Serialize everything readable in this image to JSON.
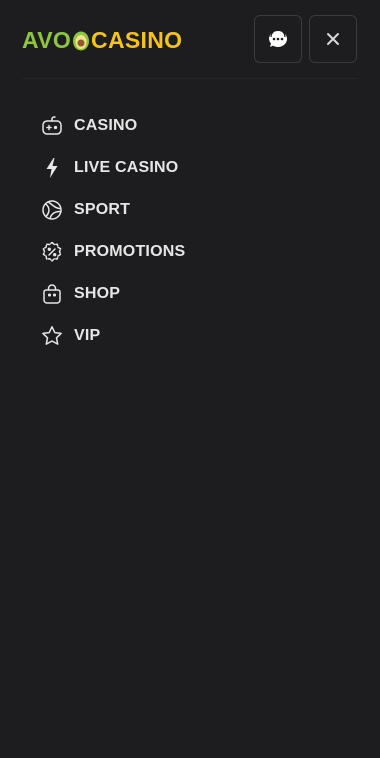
{
  "header": {
    "logo_left": "AVO",
    "logo_right": "CASINO",
    "chat_icon": "support-chat-icon",
    "close_icon": "close-icon"
  },
  "menu": {
    "items": [
      {
        "label": "CASINO",
        "icon": "gamepad-icon"
      },
      {
        "label": "LIVE CASINO",
        "icon": "lightning-icon"
      },
      {
        "label": "SPORT",
        "icon": "sport-ball-icon"
      },
      {
        "label": "PROMOTIONS",
        "icon": "discount-badge-icon"
      },
      {
        "label": "SHOP",
        "icon": "shopping-bag-icon"
      },
      {
        "label": "VIP",
        "icon": "star-icon"
      }
    ]
  },
  "colors": {
    "background": "#1d1d20",
    "logo_green": "#8cc63f",
    "logo_yellow": "#f4c31c",
    "text": "#e6e6e6",
    "border": "#3a3a3f"
  }
}
